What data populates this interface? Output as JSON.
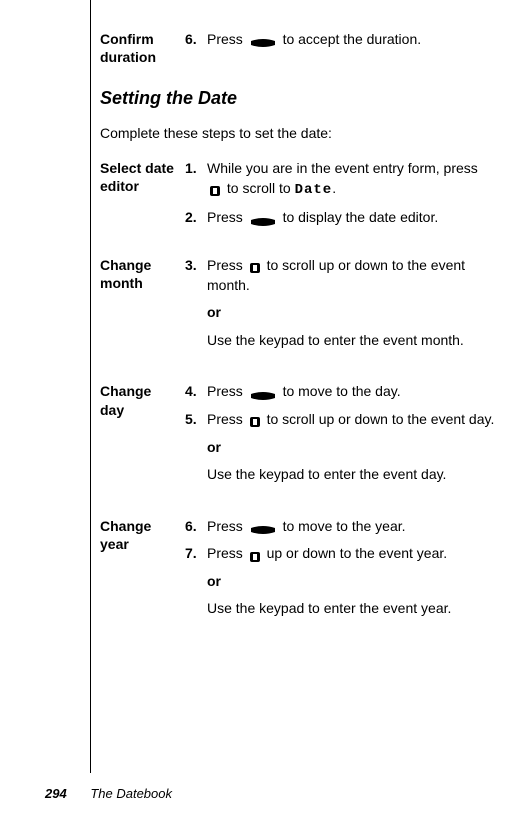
{
  "confirm_duration": {
    "label": "Confirm duration",
    "step6_num": "6.",
    "step6_a": "Press ",
    "step6_b": " to accept the duration."
  },
  "setting_date": {
    "heading": "Setting the Date",
    "intro": "Complete these steps to set the date:"
  },
  "select_date_editor": {
    "label": "Select date editor",
    "step1_num": "1.",
    "step1_a": "While you are in the event entry form, press ",
    "step1_b": " to scroll to ",
    "step1_date": "Date",
    "step1_c": ".",
    "step2_num": "2.",
    "step2_a": "Press ",
    "step2_b": " to display the date editor."
  },
  "change_month": {
    "label": "Change month",
    "step3_num": "3.",
    "step3_a": " Press ",
    "step3_b": " to scroll up or down to the event month.",
    "or": "or",
    "alt": "Use the keypad to enter the event month."
  },
  "change_day": {
    "label": "Change day",
    "step4_num": "4.",
    "step4_a": "Press ",
    "step4_b": " to move to the day.",
    "step5_num": "5.",
    "step5_a": "Press ",
    "step5_b": " to scroll up or down to the event day.",
    "or": "or",
    "alt": "Use the keypad to enter the event day."
  },
  "change_year": {
    "label": "Change year",
    "step6_num": "6.",
    "step6_a": "Press ",
    "step6_b": " to move to the year.",
    "step7_num": "7.",
    "step7_a": "Press ",
    "step7_b": " up or down to the event year.",
    "or": "or",
    "alt": "Use the keypad to enter the event year."
  },
  "footer": {
    "page_num": "294",
    "title": "The Datebook"
  }
}
